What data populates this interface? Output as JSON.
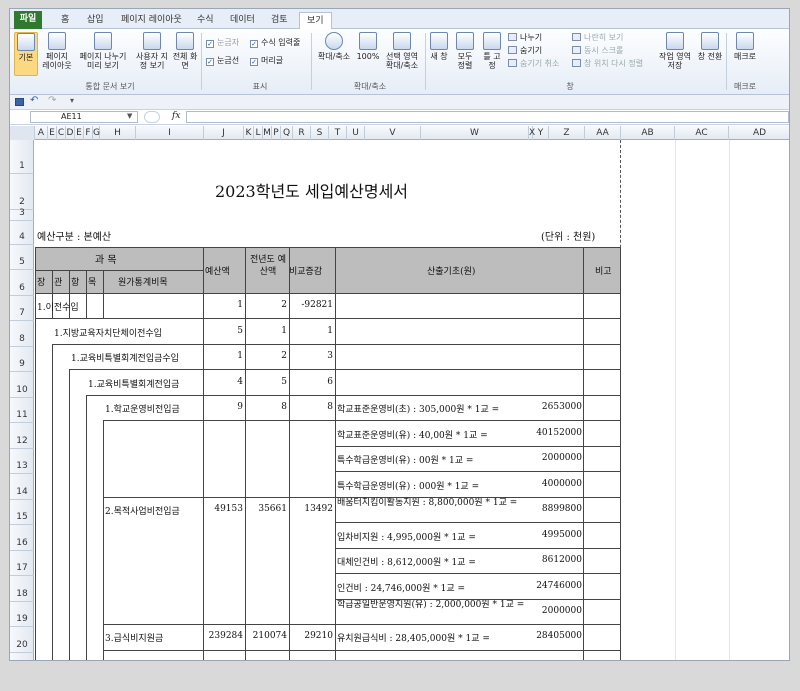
{
  "ribbon": {
    "tabs": [
      "파일",
      "홈",
      "삽입",
      "페이지 레이아웃",
      "수식",
      "데이터",
      "검토",
      "보기"
    ],
    "active_tab": "보기",
    "workbook_views": {
      "buttons": [
        "기본",
        "페이지 레이아웃",
        "페이지 나누기 미리 보기",
        "사용자 지정 보기",
        "전체 화면"
      ],
      "label": "통합 문서 보기"
    },
    "show": {
      "items": [
        "눈금자",
        "수식 입력줄",
        "눈금선",
        "머리글"
      ],
      "label": "표시"
    },
    "zoom": {
      "buttons": [
        "확대/축소",
        "100%",
        "선택 영역 확대/축소"
      ],
      "label": "확대/축소"
    },
    "window": {
      "buttons": [
        "새 창",
        "모두 정렬",
        "틀 고정"
      ],
      "small_items": [
        "나누기",
        "숨기기",
        "숨기기 취소",
        "나란히 보기",
        "동시 스크롤",
        "창 위치 다시 정렬"
      ],
      "more_buttons": [
        "작업 영역 저장",
        "창 전환"
      ],
      "label": "창"
    },
    "macros": {
      "button": "매크로",
      "label": "매크로"
    }
  },
  "formula_bar": {
    "name_box": "AE11",
    "fx": "fx"
  },
  "columns": [
    "A",
    "E",
    "C",
    "D",
    "E",
    "F",
    "G",
    "H",
    "I",
    "J",
    "K",
    "L",
    "M",
    "P",
    "Q",
    "R",
    "S",
    "T",
    "U",
    "V",
    "W",
    "X",
    "Y",
    "Z",
    "AA",
    "AB",
    "AC",
    "AD"
  ],
  "rows": [
    "1",
    "2",
    "3",
    "4",
    "5",
    "6",
    "7",
    "8",
    "9",
    "10",
    "11",
    "12",
    "13",
    "14",
    "15",
    "16",
    "17",
    "18",
    "19",
    "20"
  ],
  "document": {
    "title": "2023학년도  세입예산명세서",
    "category_label": "예산구분 :  본예산",
    "unit_label": "(단위 : 천원)",
    "headers": {
      "kwamok": "과   목",
      "jang": "장",
      "gwan": "관",
      "hang": "항",
      "mok": "목",
      "wonga": "원가통계비목",
      "budget": "예산액",
      "prev_budget": "전년도 예산액",
      "diff": "비교증감",
      "basis": "산출기초(원)",
      "remark": "비고"
    },
    "items": [
      {
        "name": "1.이전수입",
        "budget": "1",
        "prev": "2",
        "diff": "-92821"
      },
      {
        "name": "1.지방교육자치단체이전수입",
        "budget": "5",
        "prev": "1",
        "diff": "1"
      },
      {
        "name": "1.교육비특별회계전입금수입",
        "budget": "1",
        "prev": "2",
        "diff": "3"
      },
      {
        "name": "1.교육비특별회계전입금",
        "budget": "4",
        "prev": "5",
        "diff": "6"
      },
      {
        "name": "1.학교운영비전입금",
        "budget": "9",
        "prev": "8",
        "diff": "8"
      },
      {
        "name": "2.목적사업비전입금",
        "budget": "49153",
        "prev": "35661",
        "diff": "13492"
      },
      {
        "name": "3.급식비지원금",
        "budget": "239284",
        "prev": "210074",
        "diff": "29210"
      }
    ],
    "basis_lines": [
      {
        "text": "학교표준운영비(초) : 305,000원 * 1교 =",
        "amount": "2653000"
      },
      {
        "text": "학교표준운영비(유) : 40,00원 * 1교 =",
        "amount": "40152000"
      },
      {
        "text": "특수학급운영비(유) : 00원 * 1교 =",
        "amount": "2000000"
      },
      {
        "text": "특수학급운영비(유) : 000원 * 1교 =",
        "amount": "4000000"
      },
      {
        "text": "배움터지킴이활동지원 : 8,800,000원 * 1교 =",
        "amount": "8899800"
      },
      {
        "text": "입차비지원 : 4,995,000원 * 1교 =",
        "amount": "4995000"
      },
      {
        "text": "대체인건비 : 8,612,000원 * 1교 =",
        "amount": "8612000"
      },
      {
        "text": "인건비 : 24,746,000원 * 1교 =",
        "amount": "24746000"
      },
      {
        "text": "학급공일반운영지원(유) : 2,000,000원 * 1교 =",
        "amount": "2000000"
      },
      {
        "text": "유치원급식비 : 28,405,000원 * 1교 =",
        "amount": "28405000"
      }
    ]
  }
}
